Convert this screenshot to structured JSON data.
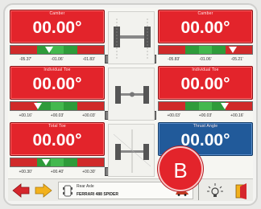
{
  "gauges": [
    {
      "label": "Camber",
      "value": "00.00°",
      "nums": [
        "-05.37'",
        "-01.06'",
        "-01.83'"
      ]
    },
    {
      "label": "Camber",
      "value": "00.00°",
      "nums": [
        "-05.83'",
        "-01.06'",
        "-05.21'"
      ]
    },
    {
      "label": "Individual Toe",
      "value": "00.00°",
      "nums": [
        "+00.16'",
        "+00.03'",
        "+00.03'"
      ]
    },
    {
      "label": "Individual Toe",
      "value": "00.00°",
      "nums": [
        "+00.03'",
        "+00.03'",
        "+00.16'"
      ]
    },
    {
      "label": "Total Toe",
      "value": "00.00°",
      "nums": [
        "+00.30'",
        "+00.40'",
        "+00.30'"
      ]
    },
    {
      "label": "Thrust Angle",
      "value": "00.00°",
      "nums": []
    }
  ],
  "bottom": {
    "line1": "Rear Axle",
    "vehicle": "FERRARI 488 SPIDER"
  },
  "badge": {
    "letter": "B"
  },
  "colors": {
    "red": "#e3242b",
    "blue": "#215a9a",
    "green": "#2e9b3a"
  },
  "icons": [
    "back-arrow-icon",
    "forward-arrow-icon",
    "vehicle-icon",
    "car-icon",
    "lamp-icon",
    "exit-icon"
  ]
}
